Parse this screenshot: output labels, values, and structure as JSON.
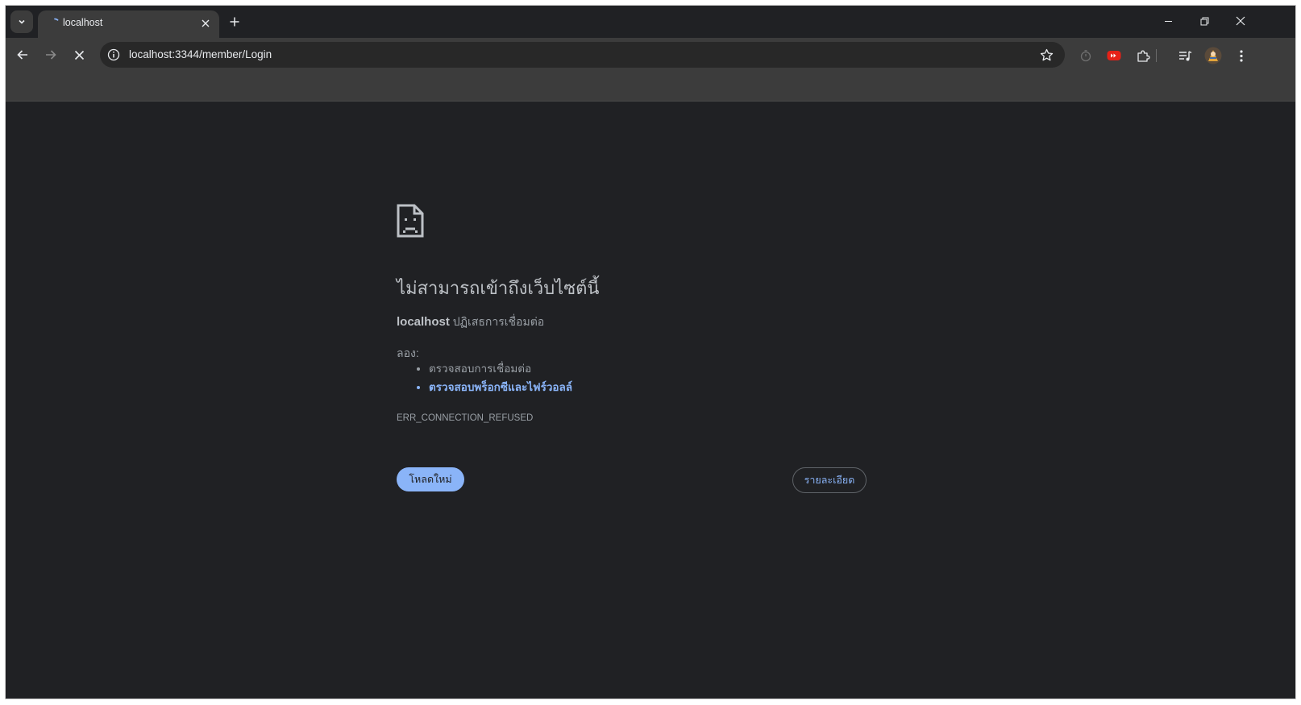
{
  "tabs": [
    {
      "title": "localhost",
      "active": true
    }
  ],
  "address_bar": {
    "url": "localhost:3344/member/Login"
  },
  "error_page": {
    "title": "ไม่สามารถเข้าถึงเว็บไซต์นี้",
    "host": "localhost",
    "description": "ปฏิเสธการเชื่อมต่อ",
    "try_label": "ลอง:",
    "suggestions": [
      {
        "text": "ตรวจสอบการเชื่อมต่อ",
        "link": false
      },
      {
        "text": "ตรวจสอบพร็อกซีและไฟร์วอลล์",
        "link": true
      }
    ],
    "error_code": "ERR_CONNECTION_REFUSED",
    "reload_label": "โหลดใหม่",
    "details_label": "รายละเอียด"
  },
  "colors": {
    "page_bg": "#202124",
    "toolbar_bg": "#3c3c3c",
    "accent": "#8ab4f8",
    "text_primary": "#bdc1c6",
    "text_secondary": "#9aa0a6"
  },
  "icons": {
    "tab_search": "chevron-down-icon",
    "favicon": "loading-spinner-icon",
    "close_tab": "close-icon",
    "new_tab": "plus-icon",
    "back": "arrow-left-icon",
    "forward": "arrow-right-icon",
    "stop": "close-icon",
    "site_info": "info-icon",
    "bookmark": "star-icon",
    "extensions": [
      "timer-icon",
      "youtube-icon",
      "puzzle-icon",
      "media-control-icon",
      "profile-avatar-icon",
      "more-vert-icon"
    ],
    "error": "sad-page-icon"
  }
}
